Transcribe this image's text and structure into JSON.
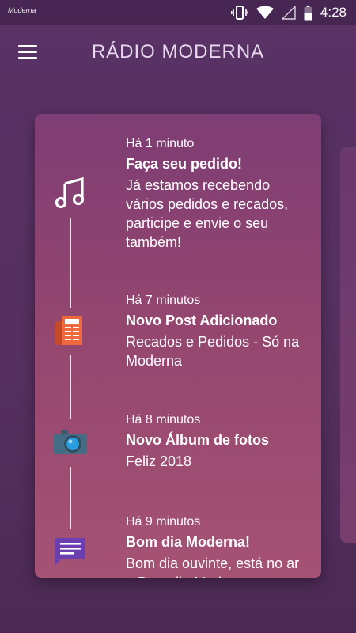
{
  "status_bar": {
    "logo_text": "Moderna",
    "time": "4:28",
    "icons": [
      "vibrate-icon",
      "wifi-icon",
      "signal-icon",
      "battery-icon"
    ]
  },
  "app_bar": {
    "title": "RÁDIO MODERNA",
    "menu_icon": "hamburger-menu-icon"
  },
  "feed": [
    {
      "icon": "music-note-icon",
      "time": "Há 1 minuto",
      "title": "Faça seu pedido!",
      "body": "Já estamos recebendo vários pedidos e recados, participe e envie o seu também!"
    },
    {
      "icon": "newspaper-icon",
      "time": "Há 7 minutos",
      "title": "Novo Post Adicionado",
      "body": "Recados e Pedidos - Só na Moderna"
    },
    {
      "icon": "camera-icon",
      "time": "Há 8 minutos",
      "title": "Novo Álbum de fotos",
      "body": "Feliz 2018"
    },
    {
      "icon": "chat-message-icon",
      "time": "Há 9 minutos",
      "title": "Bom dia Moderna!",
      "body": "Bom dia ouvinte, está no ar o Bom dia Moderna"
    }
  ],
  "colors": {
    "background": "#55305f",
    "card_top": "#7e3d74",
    "card_bottom": "#a55274",
    "newspaper_orange": "#e8643c",
    "camera_blue": "#2a9de0",
    "chat_purple": "#6b3fb0"
  }
}
